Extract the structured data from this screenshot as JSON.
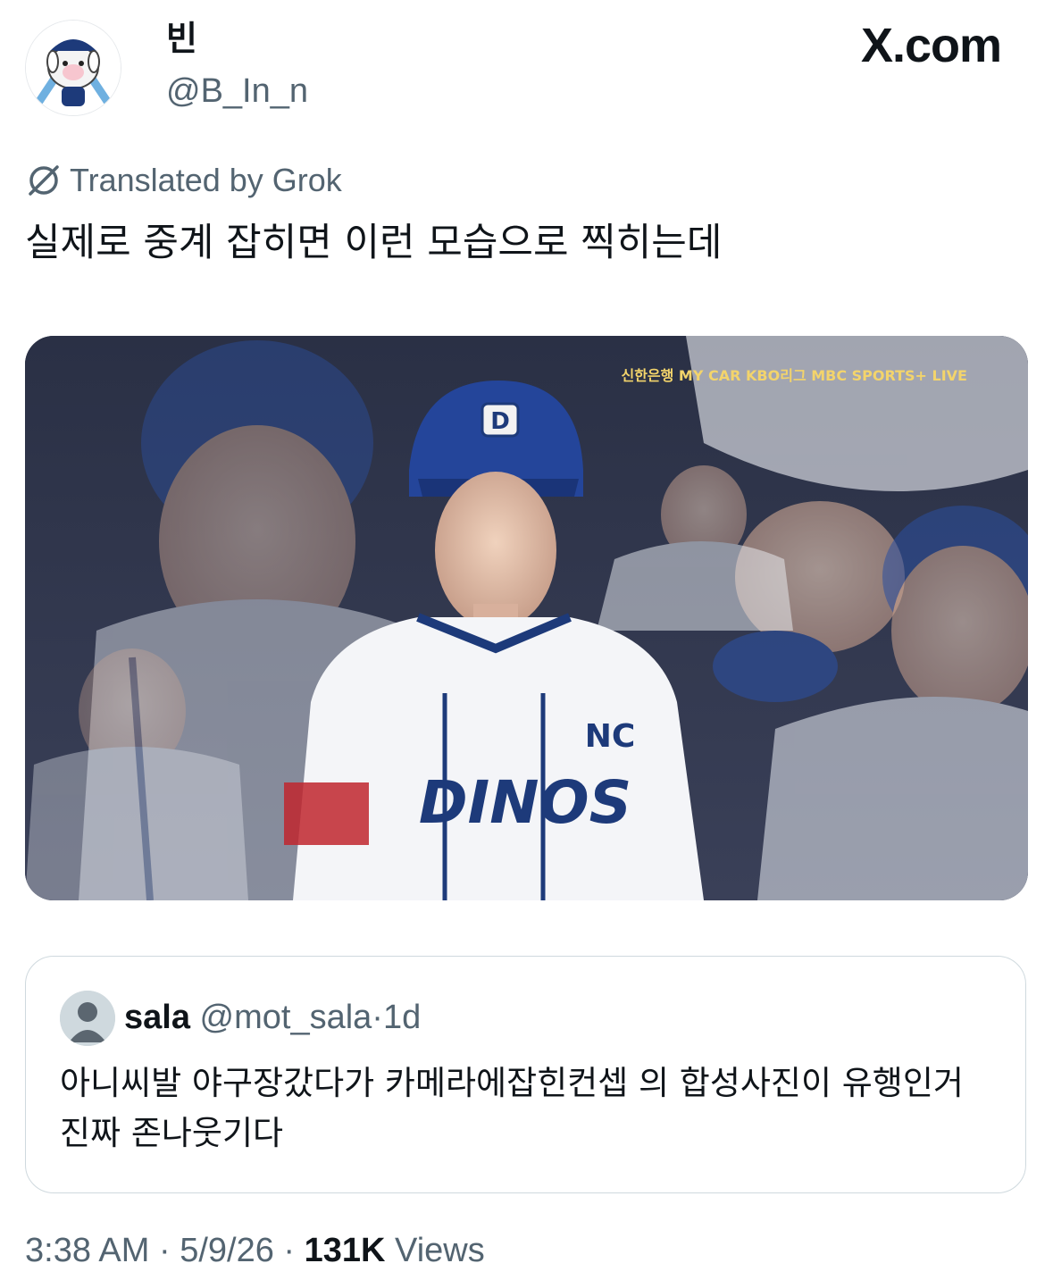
{
  "author": {
    "display_name": "빈",
    "handle": "@B_In_n",
    "avatar_icon": "mascot-avatar-icon"
  },
  "brand": {
    "site": "X.com"
  },
  "translation": {
    "label": "Translated by Grok",
    "icon": "translate-icon"
  },
  "tweet": {
    "text": "실제로 중계 잡히면 이런 모습으로 찍히는데"
  },
  "media": {
    "broadcast_overlay": "신한은행 MY CAR KBO리그 MBC SPORTS+ LIVE",
    "jersey_text": "DINOS",
    "logo": "NC"
  },
  "quote": {
    "name": "sala",
    "handle": "@mot_sala",
    "separator": "·",
    "time": "1d",
    "text": "아니씨발 야구장갔다가 카메라에잡힌컨셉 의 합성사진이 유행인거 진짜 존나웃기다"
  },
  "footer": {
    "time": "3:38 AM",
    "sep1": "·",
    "date": "5/9/26",
    "sep2": "·",
    "views_count": "131K",
    "views_label": "Views"
  },
  "colors": {
    "text_primary": "#0f1419",
    "text_secondary": "#536471",
    "border": "#cfd9de",
    "team_navy": "#1d3a7a"
  }
}
